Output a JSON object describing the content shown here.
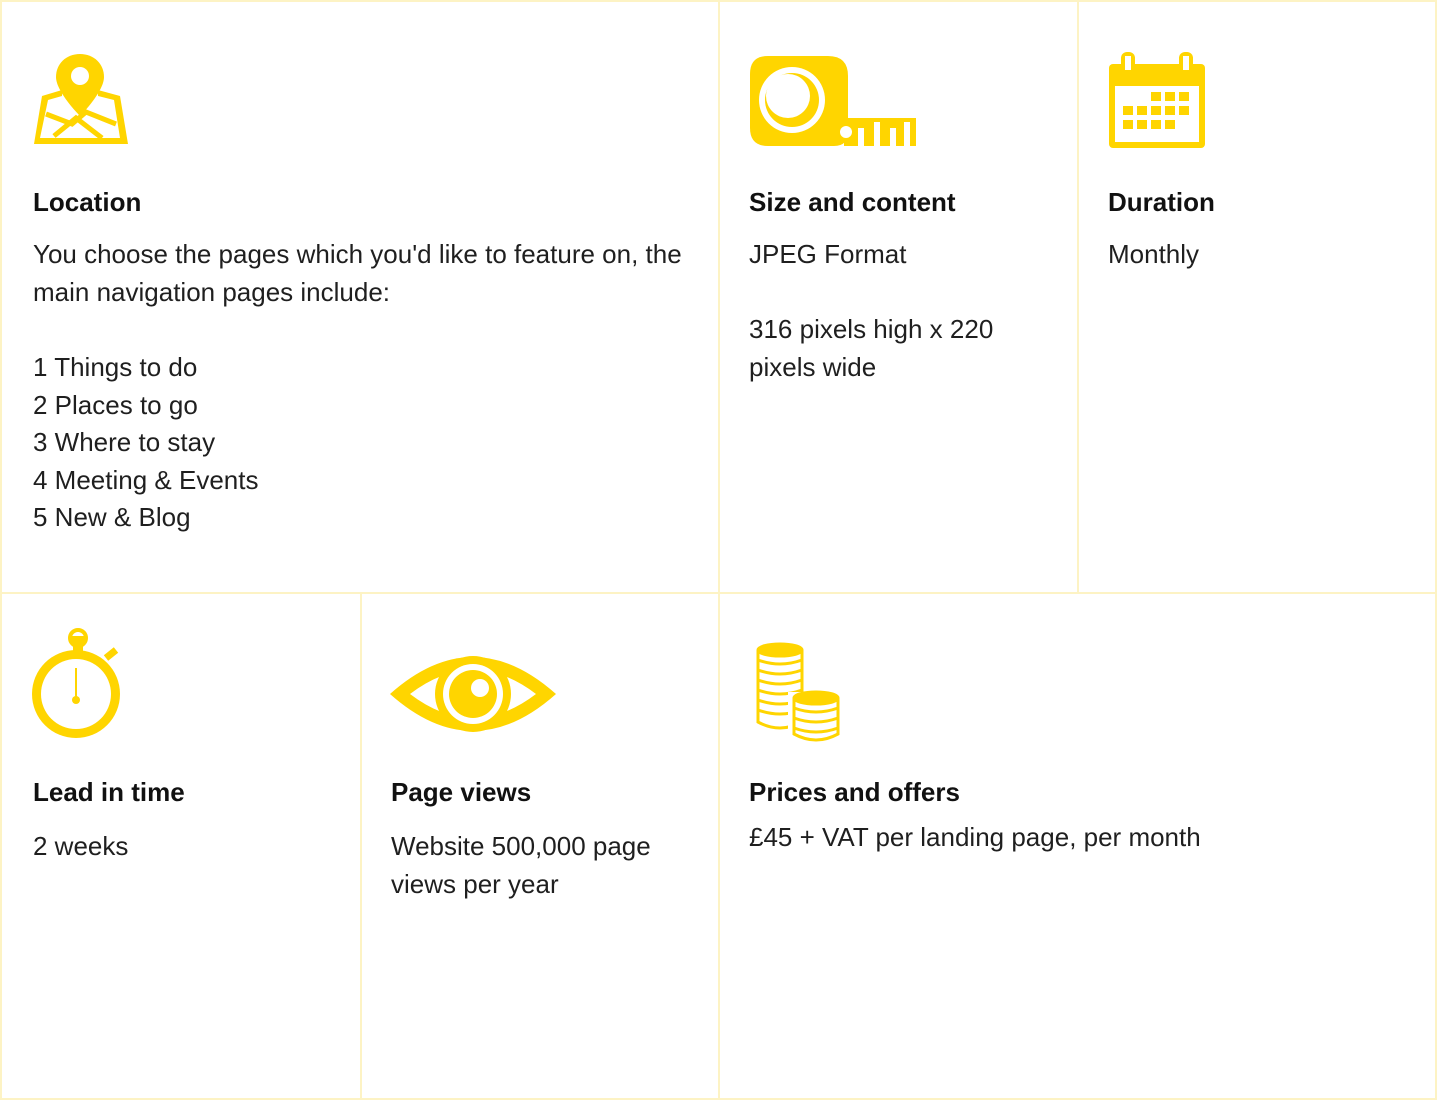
{
  "colors": {
    "accent": "#ffd500",
    "border": "#fdf3c4",
    "text": "#1f1f1f"
  },
  "cards": {
    "location": {
      "icon": "map-pin-icon",
      "title": "Location",
      "intro": "You choose the pages which you'd like to feature on, the main navigation pages include:",
      "items": [
        "1 Things to do",
        "2 Places to go",
        "3 Where to stay",
        "4 Meeting & Events",
        "5 New & Blog"
      ]
    },
    "size": {
      "icon": "tape-measure-icon",
      "title": "Size and content",
      "line1": "JPEG Format",
      "line2": "316 pixels high x 220 pixels wide"
    },
    "duration": {
      "icon": "calendar-icon",
      "title": "Duration",
      "value": "Monthly"
    },
    "lead": {
      "icon": "stopwatch-icon",
      "title": "Lead in time",
      "value": "2 weeks"
    },
    "views": {
      "icon": "eye-icon",
      "title": "Page views",
      "value": "Website 500,000 page views per year"
    },
    "prices": {
      "icon": "coins-icon",
      "title": "Prices and offers",
      "value": "£45 + VAT per landing page, per month"
    }
  }
}
